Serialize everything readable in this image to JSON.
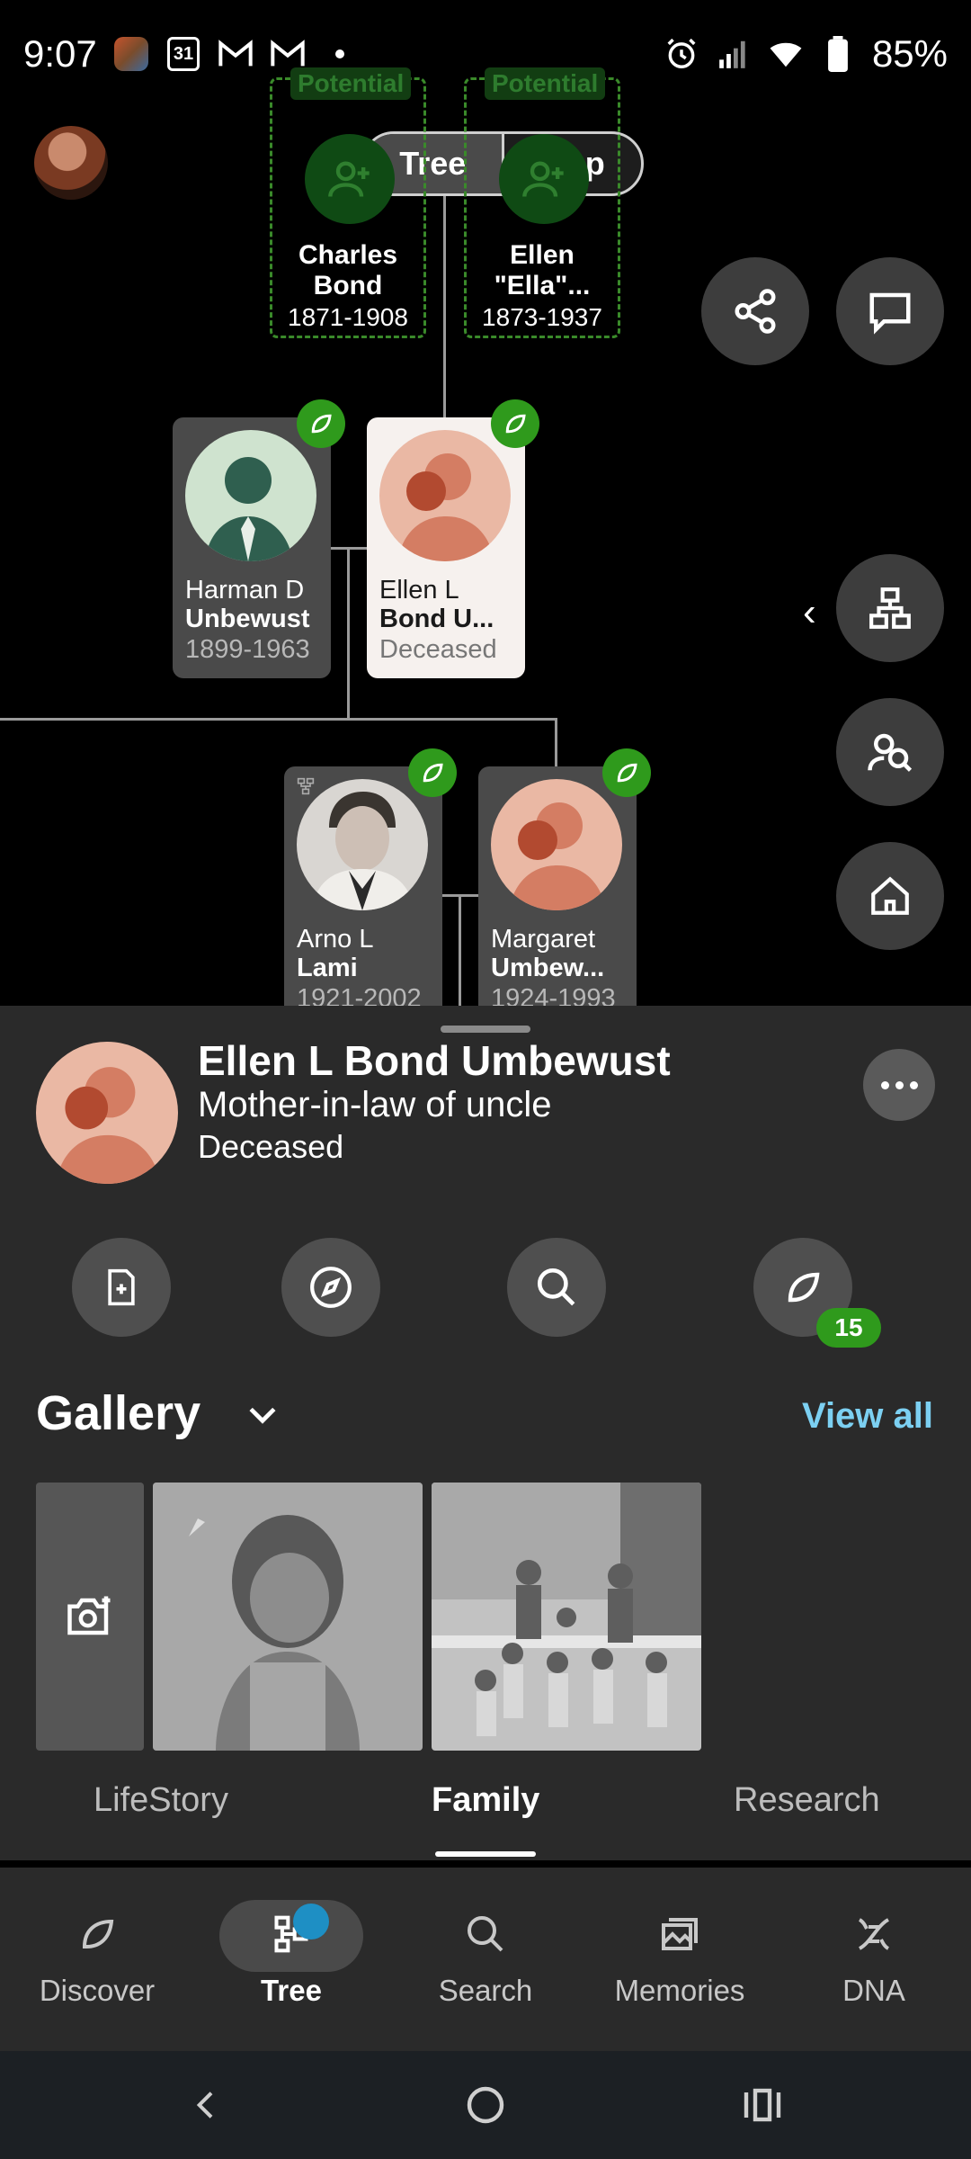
{
  "status_bar": {
    "time": "9:07",
    "battery": "85%",
    "left_icons": [
      "photo-collage-icon",
      "calendar-31-icon",
      "gmail-icon",
      "gmail-icon",
      "dot-icon"
    ],
    "right_icons": [
      "alarm-icon",
      "signal-icon",
      "wifi-icon",
      "battery-icon"
    ],
    "calendar_day": "31"
  },
  "view_toggle": {
    "tree_label": "Tree",
    "map_label": "Map",
    "selected": "Tree"
  },
  "potential_parents": [
    {
      "badge": "Potential",
      "name": "Charles Bond",
      "years": "1871-1908"
    },
    {
      "badge": "Potential",
      "name": "Ellen \"Ella\"...",
      "years": "1873-1937"
    }
  ],
  "people": [
    {
      "first": "Harman D",
      "last": "Unbewust",
      "years": "1899-1963"
    },
    {
      "first": "Ellen L",
      "last": "Bond U...",
      "years": "Deceased"
    },
    {
      "first": "Arno L",
      "last": "Lami",
      "years": "1921-2002"
    },
    {
      "first": "Margaret",
      "last": "Umbew...",
      "years": "1924-1993"
    }
  ],
  "selected_person": {
    "name": "Ellen L Bond Umbewust",
    "relation": "Mother-in-law of uncle",
    "status": "Deceased",
    "hints_count": "15"
  },
  "gallery": {
    "title": "Gallery",
    "view_all": "View all"
  },
  "profile_tabs": {
    "lifestory": "LifeStory",
    "family": "Family",
    "research": "Research",
    "active": "Family"
  },
  "bottom_nav": {
    "discover": "Discover",
    "tree": "Tree",
    "search": "Search",
    "memories": "Memories",
    "dna": "DNA",
    "active": "Tree"
  },
  "colors": {
    "hint_green": "#2f9a1c",
    "accent_blue": "#7cd0f2",
    "sheet_bg": "#2a2a2a",
    "nav_dot": "#1e8fc4"
  }
}
